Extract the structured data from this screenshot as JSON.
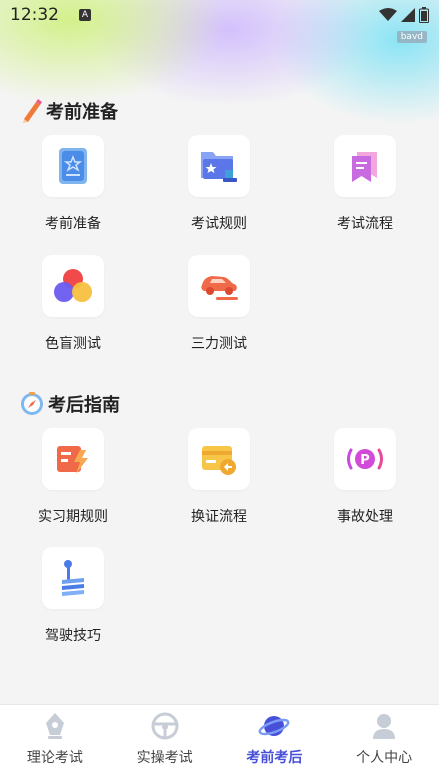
{
  "status_bar": {
    "time": "12:32",
    "badge": "A"
  },
  "corner_tag": "bavd",
  "sections": [
    {
      "title": "考前准备",
      "items": [
        {
          "label": "考前准备",
          "icon": "book-star-icon"
        },
        {
          "label": "考试规则",
          "icon": "folder-rules-icon"
        },
        {
          "label": "考试流程",
          "icon": "bookmark-flow-icon"
        },
        {
          "label": "色盲测试",
          "icon": "color-circles-icon"
        },
        {
          "label": "三力测试",
          "icon": "car-test-icon"
        }
      ]
    },
    {
      "title": "考后指南",
      "items": [
        {
          "label": "实习期规则",
          "icon": "lightning-card-icon"
        },
        {
          "label": "换证流程",
          "icon": "card-refresh-icon"
        },
        {
          "label": "事故处理",
          "icon": "parking-signal-icon"
        },
        {
          "label": "驾驶技巧",
          "icon": "gear-lever-icon"
        }
      ]
    }
  ],
  "tabs": [
    {
      "label": "理论考试",
      "icon": "pen-icon",
      "active": false
    },
    {
      "label": "实操考试",
      "icon": "steering-wheel-icon",
      "active": false
    },
    {
      "label": "考前考后",
      "icon": "planet-icon",
      "active": true
    },
    {
      "label": "个人中心",
      "icon": "user-icon",
      "active": false
    }
  ],
  "colors": {
    "accent": "#4850d8",
    "active_tab": "#4850d8",
    "inactive_tab": "#444444"
  }
}
